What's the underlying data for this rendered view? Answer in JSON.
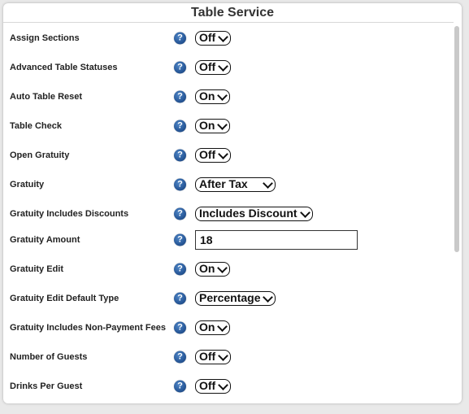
{
  "section": {
    "title": "Table Service"
  },
  "help_glyph": "?",
  "settings": [
    {
      "label": "Assign Sections",
      "control": "select",
      "value": "Off"
    },
    {
      "label": "Advanced Table Statuses",
      "control": "select",
      "value": "Off"
    },
    {
      "label": "Auto Table Reset",
      "control": "select",
      "value": "On"
    },
    {
      "label": "Table Check",
      "control": "select",
      "value": "On"
    },
    {
      "label": "Open Gratuity",
      "control": "select",
      "value": "Off"
    },
    {
      "label": "Gratuity",
      "control": "select",
      "value": "After Tax"
    },
    {
      "label": "Gratuity Includes Discounts",
      "control": "select",
      "value": "Includes Discount"
    },
    {
      "label": "Gratuity Amount",
      "control": "text",
      "value": "18"
    },
    {
      "label": "Gratuity Edit",
      "control": "select",
      "value": "On"
    },
    {
      "label": "Gratuity Edit Default Type",
      "control": "select",
      "value": "Percentage"
    },
    {
      "label": "Gratuity Includes Non-Payment Fees",
      "control": "select",
      "value": "On"
    },
    {
      "label": "Number of Guests",
      "control": "select",
      "value": "Off"
    },
    {
      "label": "Drinks Per Guest",
      "control": "select",
      "value": "Off"
    }
  ],
  "colors": {
    "help_icon": "#2a5b9c",
    "panel_bg": "#ffffff",
    "page_bg": "#e9e9e9"
  }
}
